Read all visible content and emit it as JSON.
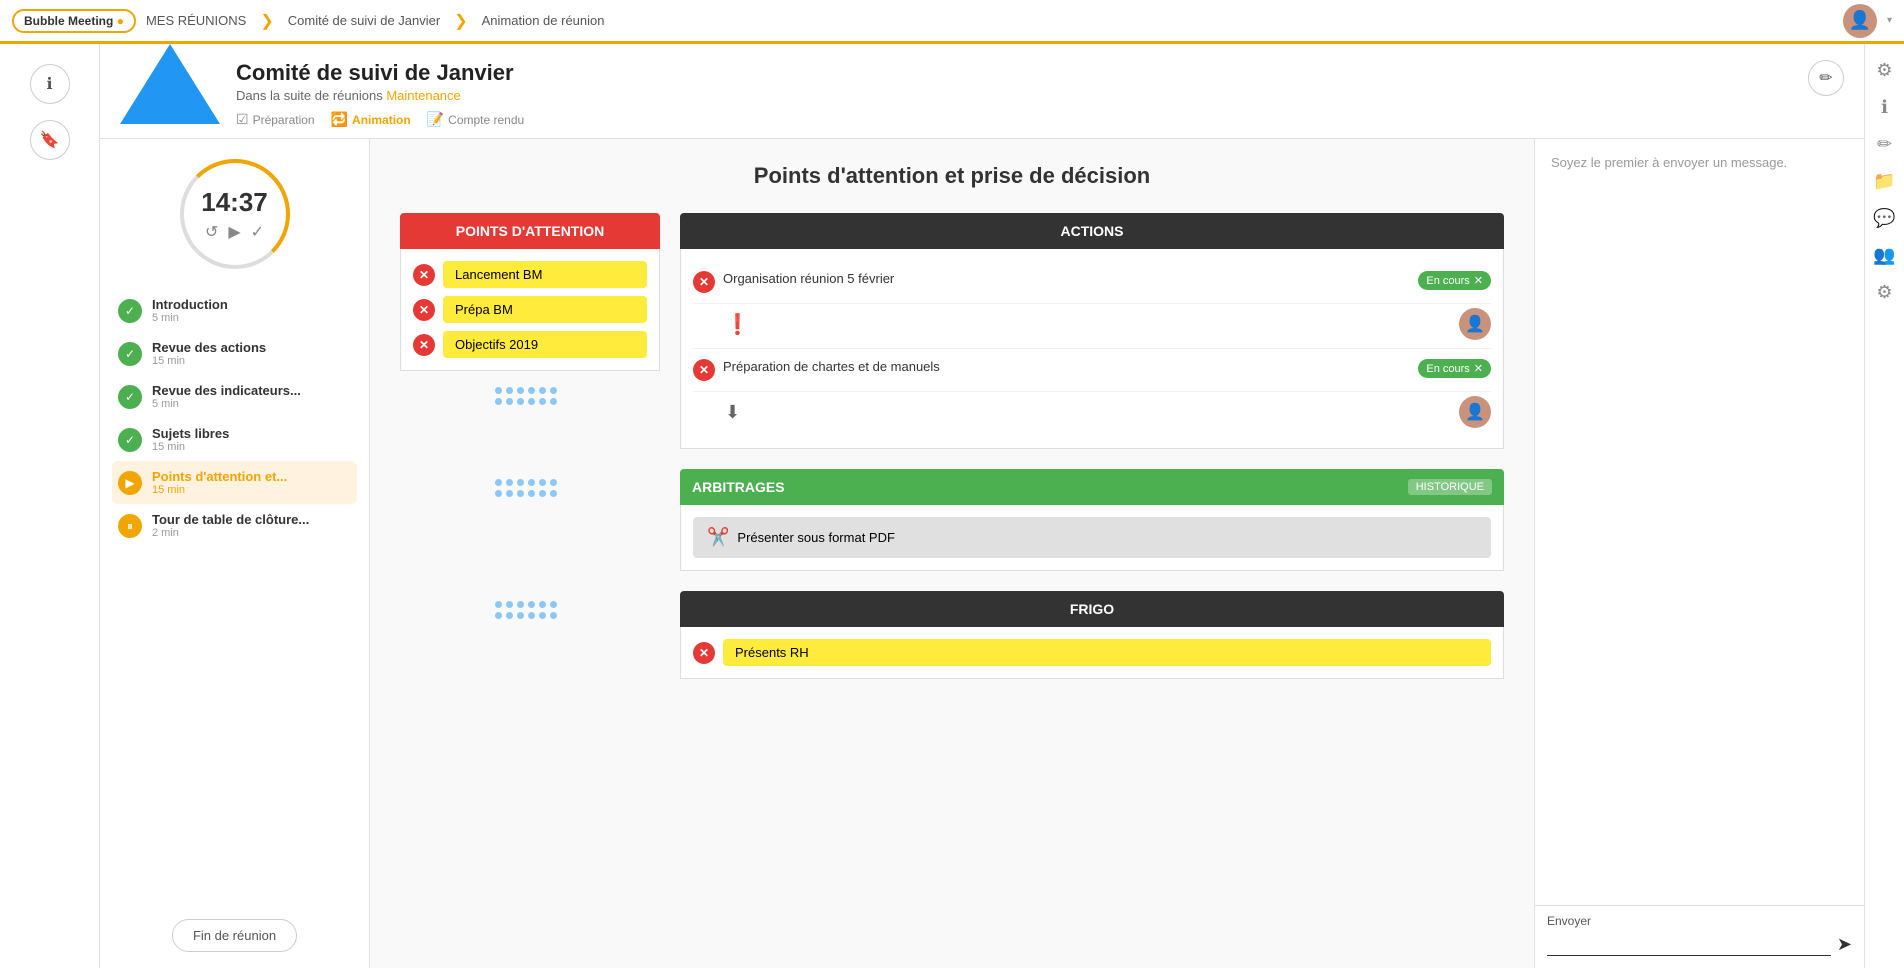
{
  "app": {
    "name": "Bubble Meeting",
    "dropdown_arrow": "▾"
  },
  "nav": {
    "mes_reunions": "MES RÉUNIONS",
    "sep1": "❯",
    "comite": "Comité de suivi de Janvier",
    "sep2": "❯",
    "animation": "Animation de réunion"
  },
  "meeting": {
    "title": "Comité de suivi de Janvier",
    "subtitle": "Dans la suite de réunions",
    "suite_link": "Maintenance",
    "tab_preparation": "Préparation",
    "tab_animation": "Animation",
    "tab_compte_rendu": "Compte rendu"
  },
  "timer": {
    "display": "14:37"
  },
  "agenda": {
    "items": [
      {
        "id": 1,
        "title": "Introduction",
        "time": "5 min",
        "status": "done"
      },
      {
        "id": 2,
        "title": "Revue des actions",
        "time": "15 min",
        "status": "done"
      },
      {
        "id": 3,
        "title": "Revue des indicateurs...",
        "time": "5 min",
        "status": "done"
      },
      {
        "id": 4,
        "title": "Sujets libres",
        "time": "15 min",
        "status": "done"
      },
      {
        "id": 5,
        "title": "Points d'attention et...",
        "time": "15 min",
        "status": "playing"
      },
      {
        "id": 6,
        "title": "Tour de table de clôture...",
        "time": "2 min",
        "status": "paused"
      }
    ],
    "fin_btn": "Fin de réunion"
  },
  "main": {
    "title": "Points d'attention et prise de décision",
    "attention": {
      "header": "POINTS D'ATTENTION",
      "items": [
        {
          "label": "Lancement BM"
        },
        {
          "label": "Prépa BM"
        },
        {
          "label": "Objectifs 2019"
        }
      ]
    },
    "actions": {
      "header": "ACTIONS",
      "items": [
        {
          "text": "Organisation réunion 5 février",
          "badge": "En cours",
          "has_avatar": true,
          "has_warning": true
        },
        {
          "text": "Préparation de chartes et de manuels",
          "badge": "En cours",
          "has_avatar": true,
          "has_download": true
        }
      ]
    },
    "arbitrages": {
      "header": "ARBITRAGES",
      "historique": "HISTORIQUE",
      "items": [
        {
          "text": "Présenter sous format PDF"
        }
      ]
    },
    "frigo": {
      "header": "FRIGO",
      "items": [
        {
          "label": "Présents RH"
        }
      ]
    }
  },
  "chat": {
    "placeholder_message": "Soyez le premier à envoyer un message.",
    "input_label": "Envoyer",
    "send_icon": "➤"
  },
  "right_icons": {
    "settings": "⚙",
    "info": "ℹ",
    "edit": "✏",
    "folder": "📁",
    "chat": "💬",
    "group": "👥",
    "gear": "⚙"
  }
}
